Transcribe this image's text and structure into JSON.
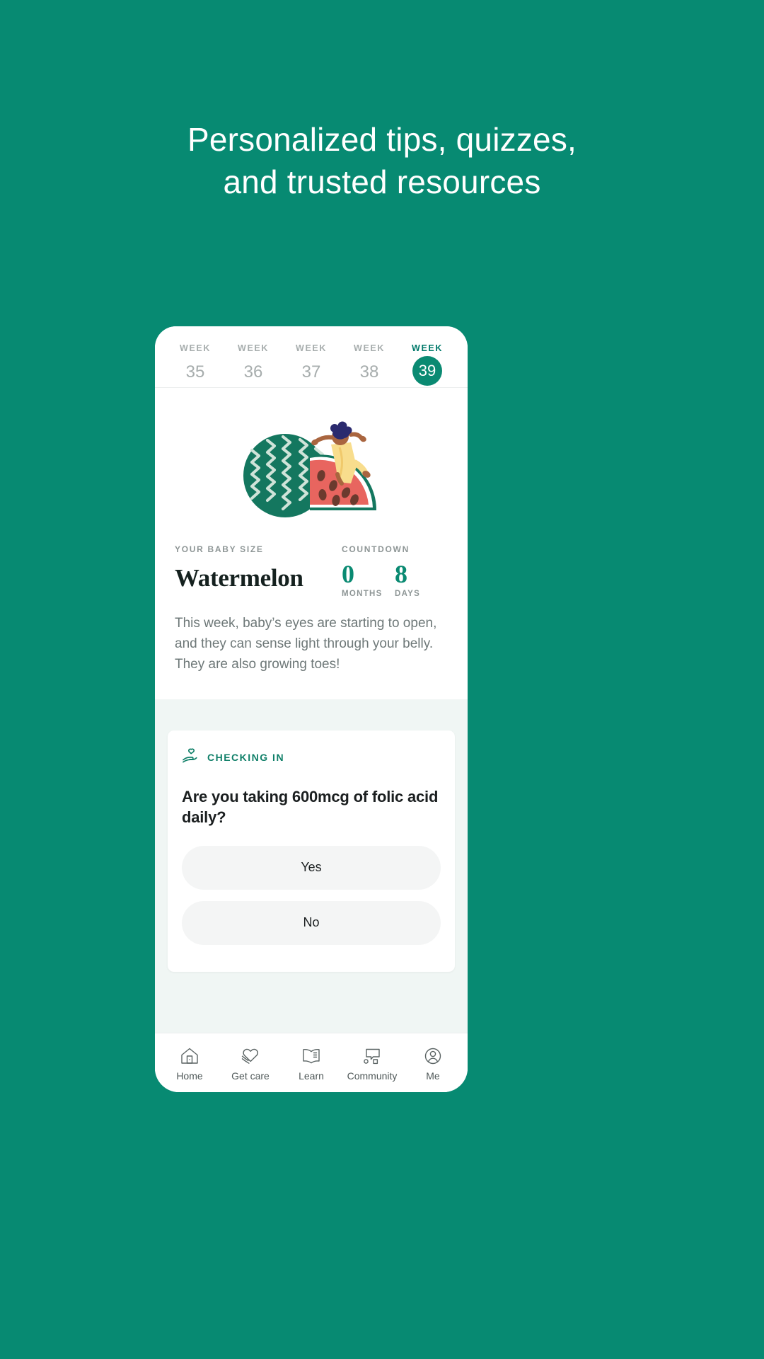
{
  "colors": {
    "background_teal": "#078a72",
    "accent_teal": "#0a8a72",
    "card_bg": "#ffffff",
    "lower_bg": "#f0f6f4",
    "answer_bg": "#f4f5f5",
    "muted_text": "#8e9696"
  },
  "headline": {
    "line1": "Personalized tips, quizzes,",
    "line2": "and trusted resources"
  },
  "phone": {
    "week_selector": {
      "weeks": [
        {
          "label": "WEEK",
          "number": "35",
          "active": false
        },
        {
          "label": "WEEK",
          "number": "36",
          "active": false
        },
        {
          "label": "WEEK",
          "number": "37",
          "active": false
        },
        {
          "label": "WEEK",
          "number": "38",
          "active": false
        },
        {
          "label": "WEEK",
          "number": "39",
          "active": true
        }
      ]
    },
    "hero": {
      "illustration_name": "watermelon-illustration",
      "baby_size_eyebrow": "YOUR BABY SIZE",
      "baby_size_value": "Watermelon",
      "countdown_eyebrow": "COUNTDOWN",
      "countdown": [
        {
          "value": "0",
          "unit": "MONTHS"
        },
        {
          "value": "8",
          "unit": "DAYS"
        }
      ],
      "description": "This week, baby’s eyes are starting to open, and they can sense light through your belly. They are also growing toes!"
    },
    "checking_in_card": {
      "icon_name": "hand-heart-icon",
      "label": "CHECKING IN",
      "question": "Are you taking 600mcg of folic acid daily?",
      "answers": [
        "Yes",
        "No"
      ]
    },
    "tabbar": {
      "tabs": [
        {
          "label": "Home",
          "icon": "home-icon"
        },
        {
          "label": "Get care",
          "icon": "heart-hand-icon"
        },
        {
          "label": "Learn",
          "icon": "open-book-icon"
        },
        {
          "label": "Community",
          "icon": "speech-bubbles-icon"
        },
        {
          "label": "Me",
          "icon": "person-circle-icon"
        }
      ]
    }
  }
}
